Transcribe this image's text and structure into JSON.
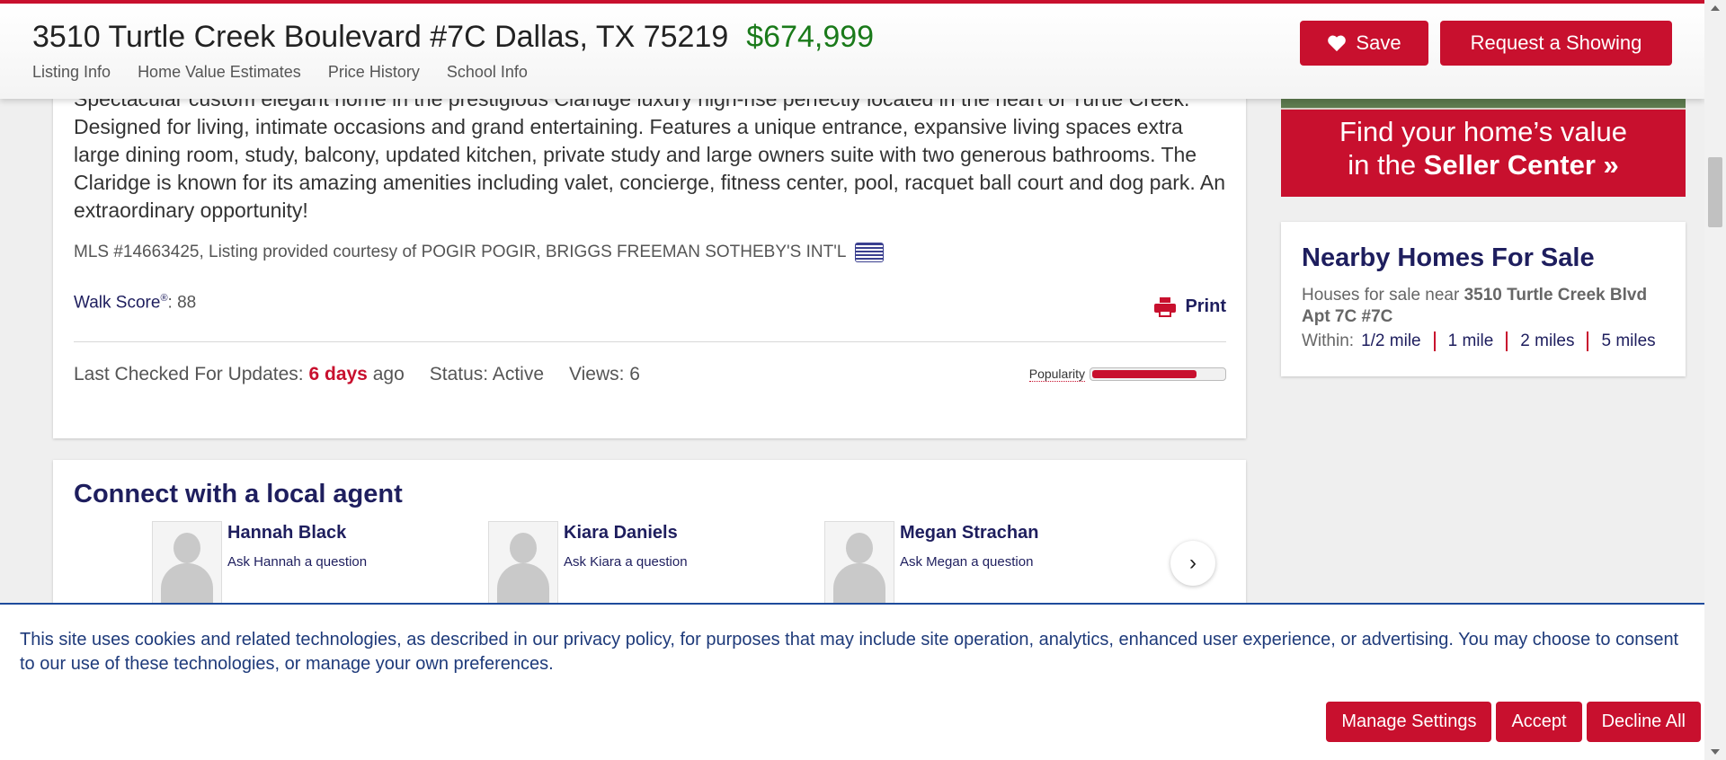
{
  "header": {
    "address": "3510 Turtle Creek Boulevard #7C Dallas, TX 75219",
    "price": "$674,999",
    "tabs": [
      "Listing Info",
      "Home Value Estimates",
      "Price History",
      "School Info"
    ],
    "save_label": "Save",
    "showing_label": "Request a Showing"
  },
  "listing": {
    "description": "Spectacular custom elegant home in the prestigious Claridge luxury high-rise perfectly located in the heart of Turtle Creek. Designed for living, intimate occasions and grand entertaining. Features a unique entrance, expansive living spaces extra large dining room, study, balcony, updated kitchen, private study and large owners suite with two generous bathrooms. The Claridge is known for its amazing amenities including valet, concierge, fitness center, pool, racquet ball court and dog park. An extraordinary opportunity!",
    "mls": "MLS #14663425, Listing provided courtesy of POGIR POGIR, BRIGGS FREEMAN SOTHEBY'S INT'L",
    "walk_score_label": "Walk Score",
    "walk_score_reg": "®",
    "walk_score_value": ": 88",
    "print_label": "Print",
    "last_checked_label": "Last Checked For Updates:",
    "last_checked_value": "6 days",
    "last_checked_suffix": "ago",
    "status": "Status: Active",
    "views": "Views: 6",
    "popularity_label": "Popularity",
    "popularity_fraction": 0.8
  },
  "agents": {
    "title": "Connect with a local agent",
    "list": [
      {
        "name": "Hannah Black",
        "ask": "Ask Hannah a question"
      },
      {
        "name": "Kiara Daniels",
        "ask": "Ask Kiara a question"
      },
      {
        "name": "Megan Strachan",
        "ask": "Ask Megan a question"
      }
    ]
  },
  "promo": {
    "line1": "Find your home’s value",
    "line2_prefix": "in the ",
    "line2_bold": "Seller Center »"
  },
  "nearby": {
    "title": "Nearby Homes For Sale",
    "sub_prefix": "Houses for sale near ",
    "sub_bold": "3510 Turtle Creek Blvd Apt 7C #7C",
    "within_label": "Within:",
    "distances": [
      "1/2 mile",
      "1 mile",
      "2 miles",
      "5 miles"
    ]
  },
  "cookie": {
    "text": "This site uses cookies and related technologies, as described in our privacy policy, for purposes that may include site operation, analytics, enhanced user experience, or advertising. You may choose to consent to our use of these technologies, or manage your own preferences.",
    "manage": "Manage Settings",
    "accept": "Accept",
    "decline": "Decline All"
  },
  "colors": {
    "brand_red": "#c8102e",
    "navy": "#1e1e5e",
    "price_green": "#1a7a1a"
  }
}
